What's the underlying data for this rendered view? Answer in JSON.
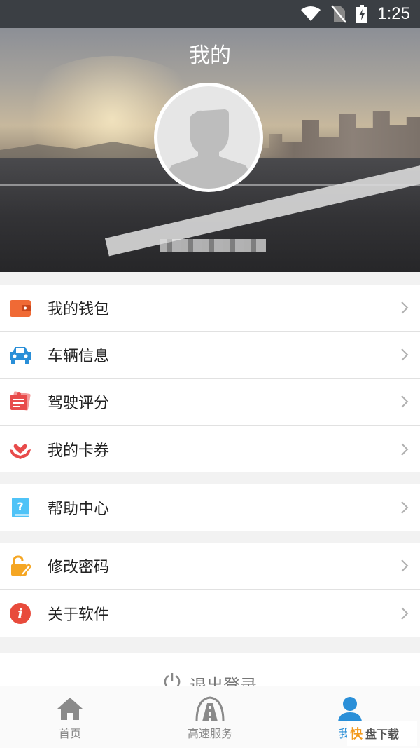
{
  "status_bar": {
    "time": "1:25"
  },
  "header": {
    "title": "我的"
  },
  "menu_groups": [
    [
      {
        "label": "我的钱包",
        "icon": "wallet-icon"
      },
      {
        "label": "车辆信息",
        "icon": "car-icon"
      },
      {
        "label": "驾驶评分",
        "icon": "driving-score-icon"
      },
      {
        "label": "我的卡券",
        "icon": "coupon-icon"
      }
    ],
    [
      {
        "label": "帮助中心",
        "icon": "help-book-icon"
      }
    ],
    [
      {
        "label": "修改密码",
        "icon": "edit-password-icon"
      },
      {
        "label": "关于软件",
        "icon": "info-icon"
      }
    ]
  ],
  "logout": {
    "label": "退出登录"
  },
  "tabs": [
    {
      "label": "首页",
      "icon": "home-icon"
    },
    {
      "label": "高速服务",
      "icon": "highway-icon"
    },
    {
      "label": "我的",
      "icon": "profile-icon",
      "active": true
    }
  ],
  "watermark": {
    "text": "盘下载",
    "logo": "快"
  },
  "colors": {
    "accent": "#2a8fd8",
    "wallet": "#f06a35",
    "car": "#2a8fd8",
    "score": "#e84b4b",
    "coupon": "#e84b4b",
    "help": "#4fc3f7",
    "password": "#f5a623",
    "info": "#e84b3c"
  }
}
